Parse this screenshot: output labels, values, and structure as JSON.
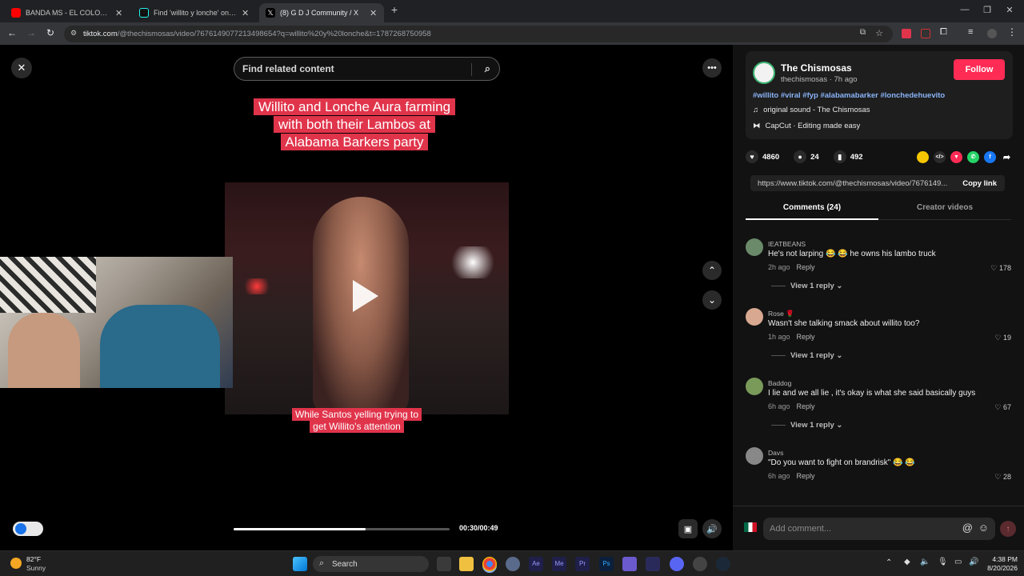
{
  "browser": {
    "tabs": [
      {
        "label": "BANDA MS - EL COLOR DE TUS",
        "icon": "youtube-icon",
        "color": "#ff0000"
      },
      {
        "label": "Find 'willito y lonche' on Tik",
        "icon": "tiktok-icon",
        "color": "#111111"
      },
      {
        "label": "(8) G D J Community / X",
        "icon": "x-icon",
        "color": "#000000"
      }
    ],
    "url_host": "tiktok.com",
    "url_path": "/@thechismosas/video/7676149077213498654?q=willito%20y%20lonche&t=1787268750958"
  },
  "video": {
    "search_placeholder": "Find related content",
    "caption": "Willito and Lonche Aura farming with both their Lambos at Alabama Barkers party",
    "subcaption": "While Santos yelling trying to get Willito's attention",
    "timecode": "00:30/00:49",
    "progress": 0.61,
    "accent": "#e0344b"
  },
  "creator": {
    "name": "The Chismosas",
    "handle_time": "thechismosas · 7h ago",
    "follow_label": "Follow",
    "hashtags": "#willito #viral #fyp #alabamabarker #lonchedehuevito",
    "sound": "original sound - The Chismosas",
    "capcut": "CapCut · Editing made easy",
    "follow_color": "#fe2c55"
  },
  "stats": {
    "likes": "4860",
    "comments": "24",
    "saves": "492"
  },
  "share": {
    "link": "https://www.tiktok.com/@thechismosas/video/7676149...",
    "copy_label": "Copy link"
  },
  "panel_tabs": {
    "comments": "Comments (24)",
    "creator": "Creator videos"
  },
  "comments": [
    {
      "user": "IEATBEANS",
      "text": "He's not larping 😂 😂 he owns his lambo truck",
      "time": "2h ago",
      "reply": "Reply",
      "likes": "178",
      "view": "View 1 reply"
    },
    {
      "user": "Rose 🌹",
      "text": "Wasn't she talking smack about willito too?",
      "time": "1h ago",
      "reply": "Reply",
      "likes": "19",
      "view": "View 1 reply"
    },
    {
      "user": "Baddog",
      "text": "I lie and we all lie , it's okay is what she said basically guys",
      "time": "6h ago",
      "reply": "Reply",
      "likes": "67",
      "view": "View 1 reply"
    },
    {
      "user": "Davs",
      "text": "\"Do you want to fight on brandrisk\" 😂 😂",
      "time": "6h ago",
      "reply": "Reply",
      "likes": "28"
    }
  ],
  "comment_input_placeholder": "Add comment...",
  "taskbar": {
    "weather_temp": "82°F",
    "weather_desc": "Sunny",
    "search_label": "Search",
    "time": "4:38 PM",
    "date": "8/20/2026"
  }
}
